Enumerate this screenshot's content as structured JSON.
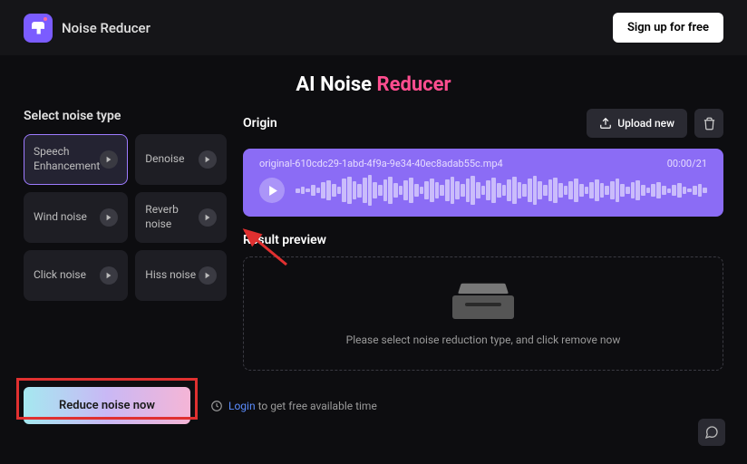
{
  "brand": "Noise Reducer",
  "signup": "Sign up for free",
  "title": {
    "p1": "AI Noise ",
    "p2": "Reducer"
  },
  "select_label": "Select noise type",
  "noise": [
    {
      "label": "Speech Enhancement",
      "selected": true
    },
    {
      "label": "Denoise",
      "selected": false
    },
    {
      "label": "Wind noise",
      "selected": false
    },
    {
      "label": "Reverb noise",
      "selected": false
    },
    {
      "label": "Click noise",
      "selected": false
    },
    {
      "label": "Hiss noise",
      "selected": false
    }
  ],
  "origin": "Origin",
  "upload": "Upload new",
  "filename": "original-610cdc29-1abd-4f9a-9e34-40ec8adab55c.mp4",
  "duration": "00:00/21",
  "result_label": "Result preview",
  "result_text": "Please select noise reduction type, and click remove now",
  "cta": "Reduce noise now",
  "login_link": "Login",
  "login_text": " to get free available time",
  "colors": {
    "accent": "#8b6cf5",
    "highlight": "#e03030"
  }
}
